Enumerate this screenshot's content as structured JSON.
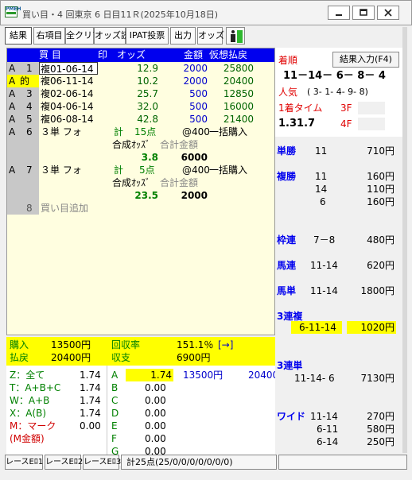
{
  "window": {
    "title": "買い目・4 回東京 6 日目11Ｒ(2025年10月18日)",
    "app_icon_text": "PMEH"
  },
  "toolbar": {
    "buttons": [
      "結果",
      "右項目",
      "全クリア",
      "オッズ読",
      "IPAT投票",
      "出力",
      "オッズ"
    ]
  },
  "grid": {
    "headers": {
      "bet": "買 目",
      "mark": "印",
      "odds": "オッズ",
      "amount": "金額",
      "payout": "仮想払戻"
    },
    "rows": [
      {
        "col_a": "A",
        "col_b": "1",
        "bet": "複01-06-14",
        "odds": "12.9",
        "amount": "2000",
        "payout": "25800"
      },
      {
        "col_a": "A",
        "col_b": "的",
        "bet": "複06-11-14",
        "odds": "10.2",
        "amount": "2000",
        "payout": "20400"
      },
      {
        "col_a": "A",
        "col_b": "3",
        "bet": "複02-06-14",
        "odds": "25.7",
        "amount": "500",
        "payout": "12850"
      },
      {
        "col_a": "A",
        "col_b": "4",
        "bet": "複04-06-14",
        "odds": "32.0",
        "amount": "500",
        "payout": "16000"
      },
      {
        "col_a": "A",
        "col_b": "5",
        "bet": "複06-08-14",
        "odds": "42.8",
        "amount": "500",
        "payout": "21400"
      }
    ],
    "formation1": {
      "col_a": "A",
      "col_b": "6",
      "type": "３単 フォ",
      "total_label": "計",
      "points": "15点",
      "unit": "@400",
      "bulk": "一括購入",
      "synth_odds_label": "合成ｵｯｽﾞ",
      "total_amount_label": "合計金額",
      "synth_odds": "3.8",
      "total_amount": "6000"
    },
    "formation2": {
      "col_a": "A",
      "col_b": "7",
      "type": "３単 フォ",
      "total_label": "計",
      "points": "5点",
      "unit": "@400",
      "bulk": "一括購入",
      "synth_odds_label": "合成ｵｯｽﾞ",
      "total_amount_label": "合計金額",
      "synth_odds": "23.5",
      "total_amount": "2000"
    },
    "add_row": {
      "num": "8",
      "label": "買い目追加"
    }
  },
  "summary": {
    "purchase_label": "購入",
    "purchase": "13500円",
    "recovery_label": "回収率",
    "recovery": "151.1％",
    "arrow": "[→]",
    "refund_label": "払戻",
    "refund": "20400円",
    "balance_label": "収支",
    "balance": "6900円",
    "marks": [
      {
        "label": "Z：全て",
        "value": "1.74"
      },
      {
        "label": "T：A+B+C",
        "value": "1.74"
      },
      {
        "label": "W：A+B",
        "value": "1.74"
      },
      {
        "label": "X：A(B)",
        "value": "1.74"
      },
      {
        "label": "M：マーク",
        "value": "0.00"
      },
      {
        "label": "(M金額)",
        "value": ""
      }
    ],
    "groups": [
      {
        "label": "A",
        "value": "1.74"
      },
      {
        "label": "B",
        "value": "0.00"
      },
      {
        "label": "C",
        "value": "0.00"
      },
      {
        "label": "D",
        "value": "0.00"
      },
      {
        "label": "E",
        "value": "0.00"
      },
      {
        "label": "F",
        "value": "0.00"
      },
      {
        "label": "G",
        "value": "0.00"
      }
    ],
    "a_amount": "13500円",
    "a_payout": "20400"
  },
  "result": {
    "order_label": "着順",
    "button": "結果入力(F4)",
    "order": "11－14－ 6－ 8－ 4",
    "pop_label": "人気",
    "pop": "( 3- 1- 4- 9- 8)",
    "time_label": "1着タイム",
    "time": "1.31.7",
    "f3_label": "3F",
    "f4_label": "4F"
  },
  "payouts": [
    {
      "type": "単勝",
      "combo": "11",
      "amount": "710円"
    },
    {
      "type": "複勝",
      "combo": "11",
      "amount": "160円"
    },
    {
      "type": "",
      "combo": "14",
      "amount": "110円"
    },
    {
      "type": "",
      "combo": "6",
      "amount": "160円"
    },
    {
      "type": "枠連",
      "combo": "7－8",
      "amount": "480円"
    },
    {
      "type": "馬連",
      "combo": "11-14",
      "amount": "620円"
    },
    {
      "type": "馬単",
      "combo": "11-14",
      "amount": "1800円"
    },
    {
      "type": "3連複",
      "combo": "6-11-14",
      "amount": "1020円"
    },
    {
      "type": "3連単",
      "combo": "11-14- 6",
      "amount": "7130円"
    },
    {
      "type": "ワイド",
      "combo": "11-14",
      "amount": "270円"
    },
    {
      "type": "",
      "combo": "6-11",
      "amount": "580円"
    },
    {
      "type": "",
      "combo": "6-14",
      "amount": "250円"
    }
  ],
  "statusbar": {
    "tabs": [
      "レースEﾛ1",
      "レースEﾛ2",
      "レースEﾛ3"
    ],
    "total": "計25点(25/0/0/0/0/0/0/0)"
  }
}
